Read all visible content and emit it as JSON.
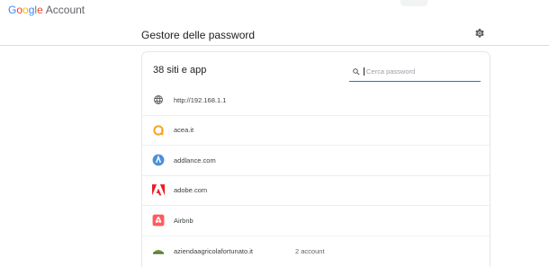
{
  "header": {
    "brand_google": "Google",
    "brand_account": "Account"
  },
  "page": {
    "title": "Gestore delle password"
  },
  "passwords": {
    "count_label": "38 siti e app",
    "search": {
      "placeholder": "Cerca password",
      "value": ""
    },
    "items": [
      {
        "site": "http://192.168.1.1",
        "icon": "globe-icon",
        "accounts": ""
      },
      {
        "site": "acea.it",
        "icon": "acea-logo-icon",
        "accounts": ""
      },
      {
        "site": "addlance.com",
        "icon": "addlance-logo-icon",
        "accounts": ""
      },
      {
        "site": "adobe.com",
        "icon": "adobe-logo-icon",
        "accounts": ""
      },
      {
        "site": "Airbnb",
        "icon": "airbnb-logo-icon",
        "accounts": ""
      },
      {
        "site": "aziendaagricolafortunato.it",
        "icon": "azienda-logo-icon",
        "accounts": "2 account"
      }
    ]
  },
  "colors": {
    "google_blue": "#4285F4",
    "google_red": "#EA4335",
    "google_yellow": "#FBBC05",
    "google_green": "#34A853",
    "accent_blue": "#1a73e8",
    "acea_orange": "#F5A623",
    "adobe_red": "#ED1C24",
    "airbnb_red": "#FF5A5F"
  }
}
